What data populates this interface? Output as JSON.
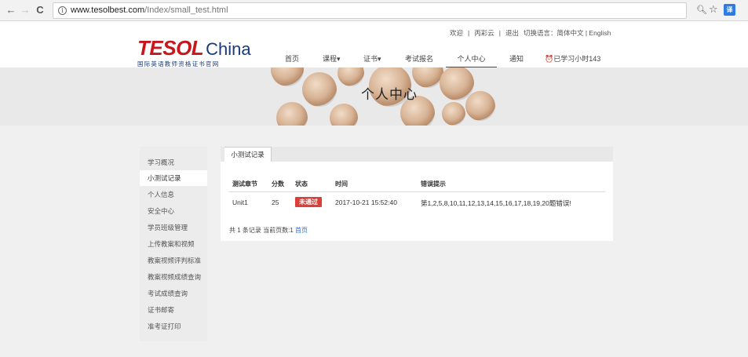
{
  "browser": {
    "back": "←",
    "forward": "→",
    "reload": "C",
    "info_icon": "i",
    "url_host": "www.tesolbest.com",
    "url_path": "/Index/small_test.html",
    "zoom_icon": "🔍︎",
    "star_icon": "☆",
    "extension_label": "译"
  },
  "topbar": {
    "welcome": "欢迎",
    "sep1": "|",
    "user": "丙彩云",
    "sep2": "|",
    "logout": "退出",
    "lang_label": "切换语言：简体中文 | English"
  },
  "logo": {
    "brand": "TESOL",
    "china": "China",
    "subtitle": "国际英语教师资格证书官网"
  },
  "nav": {
    "home": "首页",
    "courses": "课程▾",
    "certificates": "证书▾",
    "exam": "考试报名",
    "personal": "个人中心",
    "notice": "通知",
    "study_hours": "⏰已学习小时143"
  },
  "banner": {
    "title": "个人中心"
  },
  "sidebar": {
    "items": [
      "学习概况",
      "小测试记录",
      "个人信息",
      "安全中心",
      "学员班级管理",
      "上传教案和视频",
      "教案视频评判标准",
      "教案视频成绩查询",
      "考试成绩查询",
      "证书邮寄",
      "准考证打印"
    ],
    "active_index": 1
  },
  "panel": {
    "tab": "小测试记录",
    "headers": [
      "测试章节",
      "分数",
      "状态",
      "时间",
      "错误提示"
    ],
    "rows": [
      {
        "chapter": "Unit1",
        "score": "25",
        "status": "未通过",
        "time": "2017-10-21 15:52:40",
        "errors": "第1,2,5,8,10,11,12,13,14,15,16,17,18,19,20题错误!"
      }
    ],
    "pager_text": "共 1 条记录 当前页数:1",
    "pager_link": "首页"
  },
  "colors": {
    "brand_red": "#c8161d",
    "brand_blue": "#1a3a7a",
    "fail_badge": "#d9403a",
    "link": "#2f6fc9"
  }
}
